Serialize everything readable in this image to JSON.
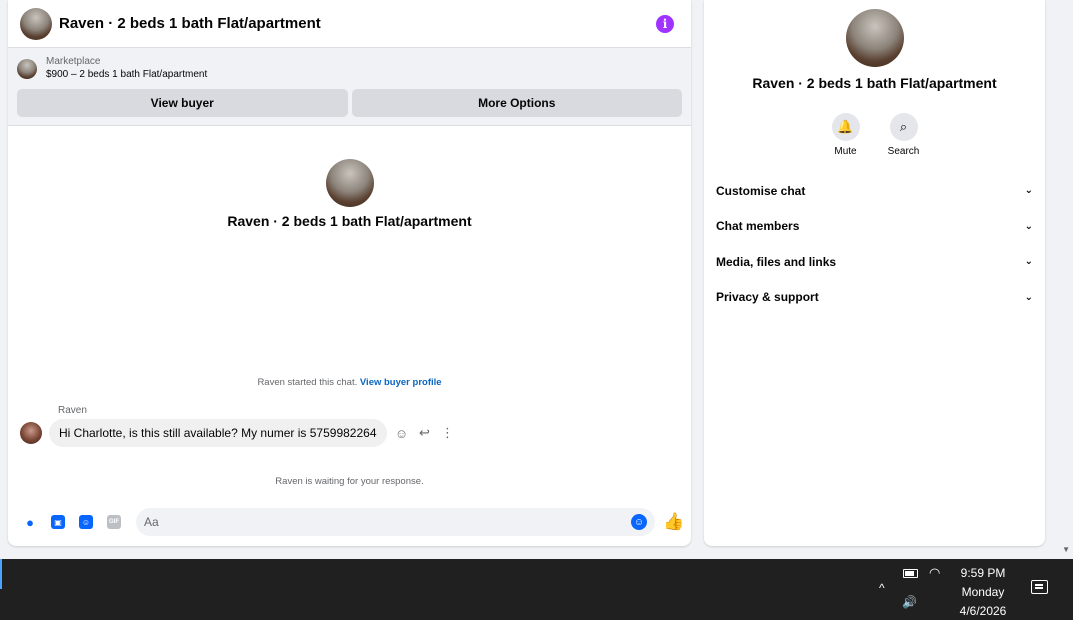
{
  "chat": {
    "header": {
      "title": "Raven · 2 beds 1 bath Flat/apartment",
      "info_icon": "i"
    },
    "marketplace": {
      "label": "Marketplace",
      "listing": "$900 – 2 beds 1 bath Flat/apartment",
      "view_buyer": "View buyer",
      "more_options": "More Options"
    },
    "profile": {
      "title": "Raven · 2 beds 1 bath Flat/apartment"
    },
    "started": {
      "text": "Raven started this chat.",
      "link": "View buyer profile"
    },
    "message": {
      "sender": "Raven",
      "text": "Hi Charlotte, is this still available? My numer is  5759982264"
    },
    "waiting": "Raven is waiting for your response.",
    "composer": {
      "placeholder": "Aa"
    }
  },
  "side": {
    "title": "Raven · 2 beds 1 bath Flat/apartment",
    "actions": [
      {
        "label": "Mute",
        "icon": "bell-icon"
      },
      {
        "label": "Search",
        "icon": "search-icon"
      }
    ],
    "items": [
      {
        "label": "Customise chat"
      },
      {
        "label": "Chat members"
      },
      {
        "label": "Media, files and links"
      },
      {
        "label": "Privacy & support"
      }
    ]
  },
  "taskbar": {
    "time": "9:59 PM",
    "day": "Monday",
    "date": "4/6/2026"
  },
  "colors": {
    "accent": "#0866ff",
    "info": "#a033ff"
  }
}
